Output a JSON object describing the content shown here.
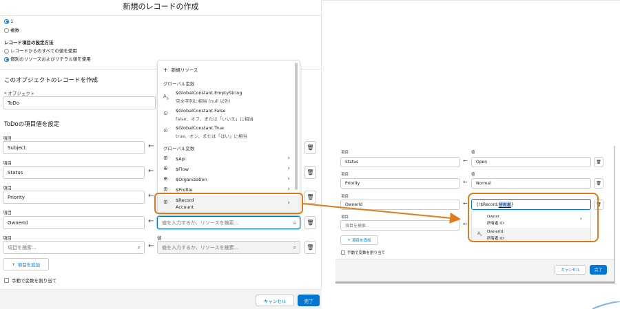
{
  "left": {
    "title": "新規のレコードの作成",
    "count": {
      "one": "1",
      "many": "複数"
    },
    "method": {
      "heading": "レコード項目の設定方法",
      "opt_all": "レコードからのすべての値を使用",
      "opt_each": "個別のリソースおよびリテラル値を使用"
    },
    "object_section": {
      "heading": "このオブジェクトのレコードを作成",
      "required_mark": "*",
      "label": "オブジェクト",
      "value": "ToDo"
    },
    "fields_heading": "ToDoの項目値を設定",
    "field_label": "項目",
    "value_label": "値",
    "rows": [
      {
        "field": "Subject"
      },
      {
        "field": "Status"
      },
      {
        "field": "Priority"
      },
      {
        "field": "OwnerId",
        "value_placeholder": "値を入力するか、リソースを検索..."
      },
      {
        "field_placeholder": "項目を検索...",
        "value_placeholder": "値を入力するか、リソースを検索..."
      }
    ],
    "add_field": "項目を追加",
    "manual_assign": "手動で変数を割り当て",
    "cancel": "キャンセル",
    "done": "完了"
  },
  "dropdown": {
    "new_resource": "新規リソース",
    "global_constants_heading": "グローバル定数",
    "constants": [
      {
        "name": "$GlobalConstant.EmptyString",
        "desc": "空文字列に相当 (null 以外)"
      },
      {
        "name": "$GlobalConstant.False",
        "desc": "false、オフ、または「いいえ」に相当"
      },
      {
        "name": "$GlobalConstant.True",
        "desc": "true、オン、または「はい」に相当"
      }
    ],
    "global_vars_heading": "グローバル変数",
    "vars": [
      "$Api",
      "$Flow",
      "$Organization",
      "$Profile"
    ],
    "record": {
      "name": "$Record",
      "sub": "Account"
    }
  },
  "right": {
    "field_label": "項目",
    "value_label": "値",
    "rows": [
      {
        "field": "Status",
        "value": "Open"
      },
      {
        "field": "Priority",
        "value": "Normal"
      },
      {
        "field": "OwnerId",
        "value_prefix": "{!$Record.",
        "value_highlight": "所有者",
        "value_suffix": "}"
      },
      {
        "field_placeholder": "項目を検索..."
      }
    ],
    "options": [
      {
        "name": "Owner",
        "desc": "所有者 ID"
      },
      {
        "name": "OwnerId",
        "desc": "所有者 ID"
      }
    ],
    "add_field": "項目を追加",
    "manual_assign": "手動で変数を割り当て",
    "cancel": "キャンセル",
    "done": "完了"
  },
  "colors": {
    "accent": "#0176d3",
    "callout": "#e07b1a"
  }
}
